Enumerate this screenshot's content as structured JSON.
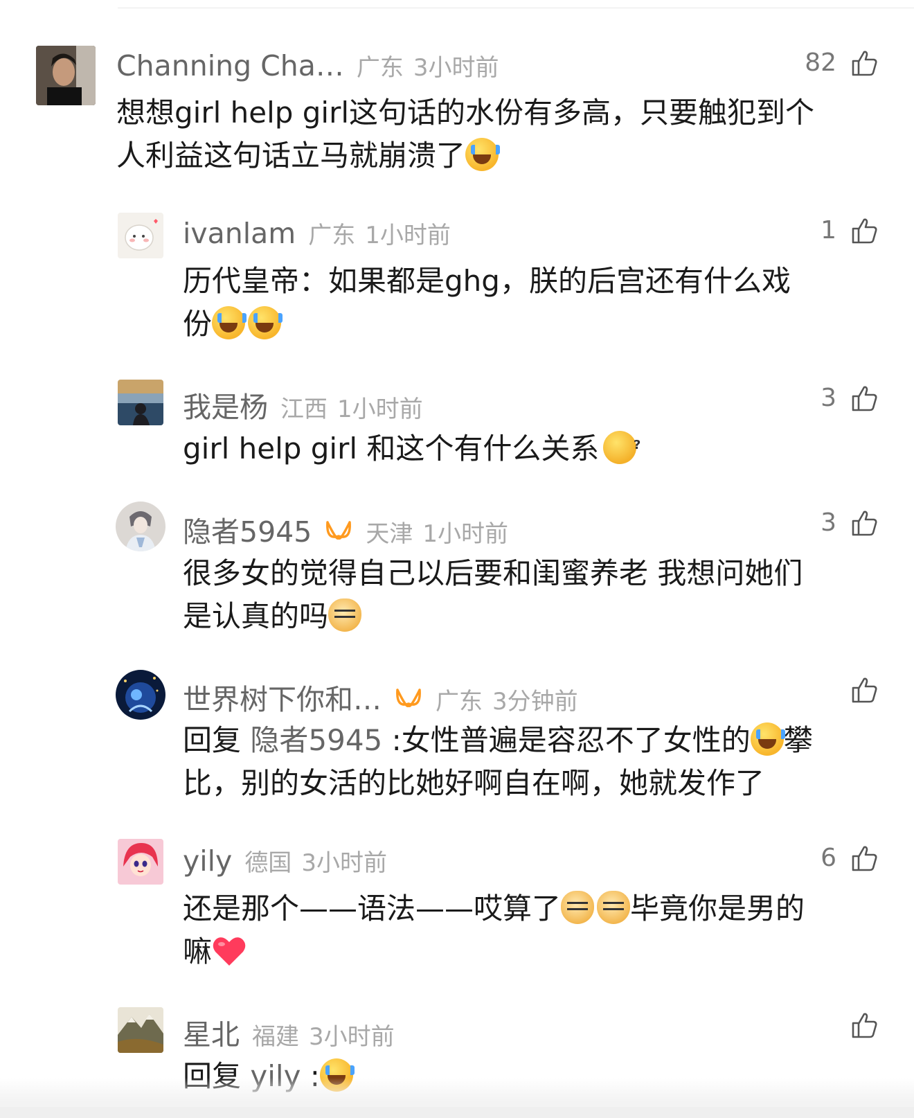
{
  "comments": [
    {
      "username": "Channing Cha…",
      "location": "广东",
      "time": "3小时前",
      "likes": "82",
      "text_1": "想想girl help girl这句话的水份有多高，只要触犯到个",
      "text_2": "人利益这句话立马就崩溃了",
      "emojis": [
        "laugh-cry"
      ]
    },
    {
      "username": "ivanlam",
      "location": "广东",
      "time": "1小时前",
      "likes": "1",
      "text_1": "历代皇帝：如果都是ghg，朕的后宫还有什么戏",
      "text_2": "份",
      "emojis": [
        "laugh-cry",
        "laugh-cry"
      ]
    },
    {
      "username": "我是杨",
      "location": "江西",
      "time": "1小时前",
      "likes": "3",
      "text_1": "girl help girl 和这个有什么关系",
      "emojis": [
        "question-face"
      ]
    },
    {
      "username": "隐者5945",
      "badge": "vip",
      "location": "天津",
      "time": "1小时前",
      "likes": "3",
      "text_1": "很多女的觉得自己以后要和闺蜜养老 我想问她们",
      "text_2": "是认真的吗",
      "emojis": [
        "doge"
      ]
    },
    {
      "username": "世界树下你和…",
      "badge": "vip",
      "location": "广东",
      "time": "3分钟前",
      "likes": "",
      "reply_prefix": "回复",
      "reply_target": "隐者5945",
      "text_1": ":女性普遍是容忍不了女性的",
      "text_1b": "攀",
      "text_2": "比，别的女活的比她好啊自在啊，她就发作了",
      "emojis": [
        "laugh-cry"
      ]
    },
    {
      "username": "yily",
      "location": "德国",
      "time": "3小时前",
      "likes": "6",
      "text_1": "还是那个——语法——哎算了",
      "text_1b": "毕竟你是男的",
      "text_2": "嘛",
      "emojis": [
        "doge",
        "doge",
        "heart"
      ]
    },
    {
      "username": "星北",
      "location": "福建",
      "time": "3小时前",
      "likes": "",
      "reply_prefix": "回复",
      "reply_target": "yily",
      "text_1": ":",
      "emojis": [
        "laugh-cry"
      ]
    }
  ],
  "colors": {
    "username": "#666666",
    "meta": "#a8a8a8",
    "vip_badge": "#ff9a1f",
    "text": "#1a1a1a"
  },
  "icons": [
    "thumbs-up-icon",
    "vip-badge-icon"
  ]
}
